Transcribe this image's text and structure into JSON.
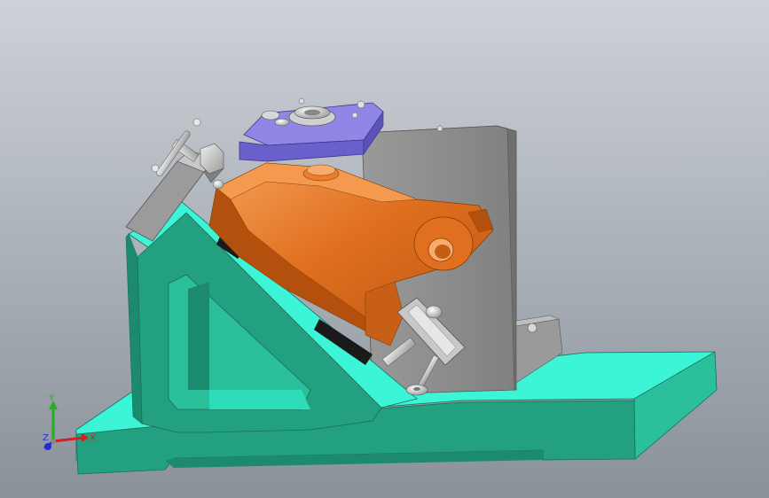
{
  "scene": {
    "background_top": "#cdd2d8",
    "background_bottom": "#8a9199"
  },
  "colors": {
    "base_top": "#3cf5d6",
    "base_front": "#22a07f",
    "base_side": "#2bbf9b",
    "base_edge": "#1a6e5a",
    "backplate_front": "#8f8f8f",
    "backplate_side": "#6f6f6f",
    "backplate_top": "#b5b5b5",
    "workpiece": "#e0701f",
    "workpiece_dark": "#b3500e",
    "workpiece_light": "#f39a4f",
    "fixture_plate": "#8f86e6",
    "fixture_plate_side": "#5b52b8",
    "clamp_metal": "#c8c8c8",
    "clamp_metal_dark": "#8a8a8a",
    "pad": "#1a1a1a"
  },
  "axis_triad": {
    "x_label": "X",
    "y_label": "Y",
    "z_label": "Z",
    "x_color": "#d62020",
    "y_color": "#22b022",
    "z_color": "#2030d0"
  }
}
